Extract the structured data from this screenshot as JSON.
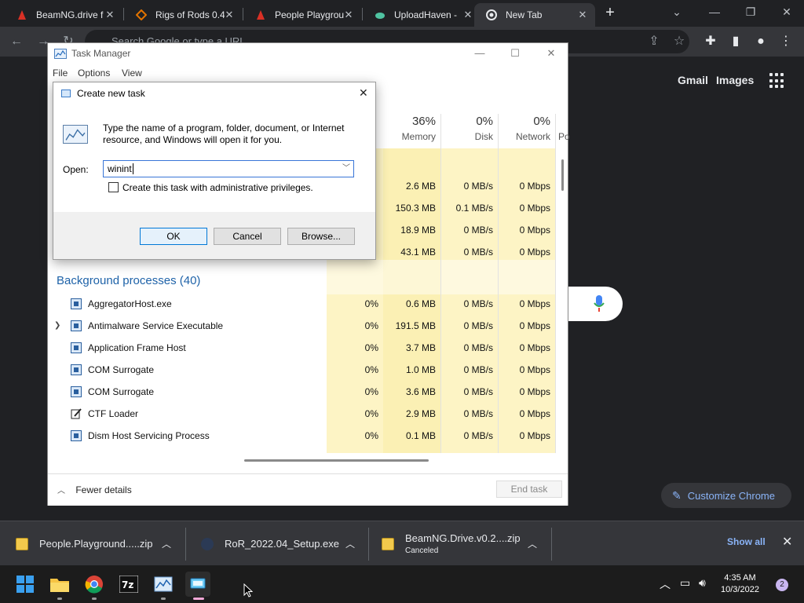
{
  "browser": {
    "tabs": [
      {
        "title": "BeamNG.drive f",
        "icon": "beamng-icon",
        "active": false
      },
      {
        "title": "Rigs of Rods 0.4",
        "icon": "rigs-of-rods-icon",
        "active": false
      },
      {
        "title": "People Playgrou",
        "icon": "people-playground-icon",
        "active": false
      },
      {
        "title": "UploadHaven - ",
        "icon": "uploadhaven-icon",
        "active": false
      },
      {
        "title": "New Tab",
        "icon": "chrome-icon",
        "active": true
      }
    ],
    "omnibox_placeholder": "Search Google or type a URL",
    "ntp_links": {
      "gmail": "Gmail",
      "images": "Images"
    },
    "customize_label": "Customize Chrome"
  },
  "downloads": [
    {
      "name": "People.Playground.....zip",
      "status": ""
    },
    {
      "name": "RoR_2022.04_Setup.exe",
      "status": ""
    },
    {
      "name": "BeamNG.Drive.v0.2....zip",
      "status": "Canceled"
    }
  ],
  "downloads_show_all": "Show all",
  "task_manager": {
    "title": "Task Manager",
    "menu": [
      "File",
      "Options",
      "View"
    ],
    "columns": [
      {
        "pct": "36%",
        "label": "Memory"
      },
      {
        "pct": "0%",
        "label": "Disk"
      },
      {
        "pct": "0%",
        "label": "Network"
      },
      {
        "pct": "",
        "label": "Po"
      }
    ],
    "app_rows": [
      {
        "memory": "2.6 MB",
        "disk": "0 MB/s",
        "network": "0 Mbps"
      },
      {
        "memory": "150.3 MB",
        "disk": "0.1 MB/s",
        "network": "0 Mbps"
      },
      {
        "memory": "18.9 MB",
        "disk": "0 MB/s",
        "network": "0 Mbps"
      },
      {
        "memory": "43.1 MB",
        "disk": "0 MB/s",
        "network": "0 Mbps"
      }
    ],
    "background_title": "Background processes (40)",
    "background_rows": [
      {
        "name": "AggregatorHost.exe",
        "cpu": "0%",
        "memory": "0.6 MB",
        "disk": "0 MB/s",
        "network": "0 Mbps",
        "expandable": false
      },
      {
        "name": "Antimalware Service Executable",
        "cpu": "0%",
        "memory": "191.5 MB",
        "disk": "0 MB/s",
        "network": "0 Mbps",
        "expandable": true
      },
      {
        "name": "Application Frame Host",
        "cpu": "0%",
        "memory": "3.7 MB",
        "disk": "0 MB/s",
        "network": "0 Mbps",
        "expandable": false
      },
      {
        "name": "COM Surrogate",
        "cpu": "0%",
        "memory": "1.0 MB",
        "disk": "0 MB/s",
        "network": "0 Mbps",
        "expandable": false
      },
      {
        "name": "COM Surrogate",
        "cpu": "0%",
        "memory": "3.6 MB",
        "disk": "0 MB/s",
        "network": "0 Mbps",
        "expandable": false
      },
      {
        "name": "CTF Loader",
        "cpu": "0%",
        "memory": "2.9 MB",
        "disk": "0 MB/s",
        "network": "0 Mbps",
        "expandable": false
      },
      {
        "name": "Dism Host Servicing Process",
        "cpu": "0%",
        "memory": "0.1 MB",
        "disk": "0 MB/s",
        "network": "0 Mbps",
        "expandable": false
      }
    ],
    "fewer_details": "Fewer details",
    "end_task": "End task"
  },
  "run_dialog": {
    "title": "Create new task",
    "description": "Type the name of a program, folder, document, or Internet resource, and Windows will open it for you.",
    "open_label": "Open:",
    "open_value": "winint",
    "admin_checkbox_label": "Create this task with administrative privileges.",
    "admin_checked": false,
    "ok_label": "OK",
    "cancel_label": "Cancel",
    "browse_label": "Browse..."
  },
  "taskbar": {
    "time": "4:35 AM",
    "date": "10/3/2022",
    "notification_count": "2",
    "apps": [
      "start-icon",
      "file-explorer-icon",
      "chrome-icon",
      "7zip-icon",
      "task-manager-icon",
      "run-icon"
    ]
  },
  "colors": {
    "accent_blue": "#1e62a8",
    "heat_light": "#fdf4c5",
    "heat_mid": "#fbf0b4",
    "chrome_dark": "#202124",
    "chrome_link": "#8ab4f8"
  }
}
